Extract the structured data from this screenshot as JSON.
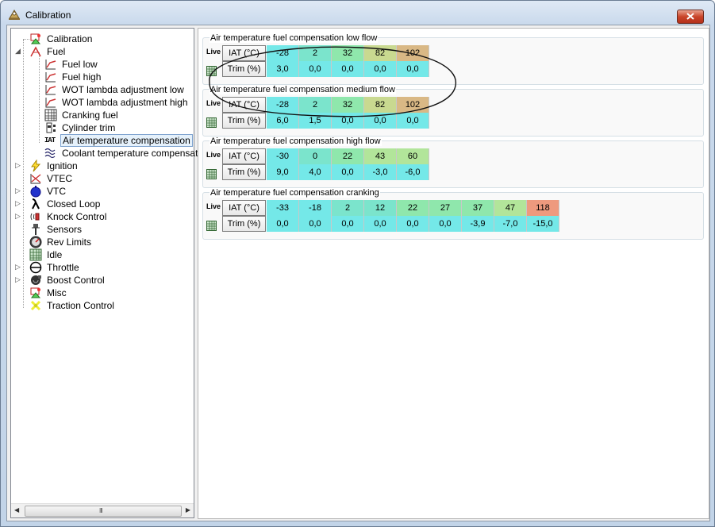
{
  "window": {
    "title": "Calibration"
  },
  "tree": {
    "items": [
      {
        "label": "Calibration"
      },
      {
        "label": "Fuel"
      },
      {
        "label": "Fuel low"
      },
      {
        "label": "Fuel high"
      },
      {
        "label": "WOT lambda adjustment low"
      },
      {
        "label": "WOT lambda adjustment high"
      },
      {
        "label": "Cranking fuel"
      },
      {
        "label": "Cylinder trim"
      },
      {
        "label": "Air temperature compensation"
      },
      {
        "label": "Coolant temperature compensation"
      },
      {
        "label": "Ignition"
      },
      {
        "label": "VTEC"
      },
      {
        "label": "VTC"
      },
      {
        "label": "Closed Loop"
      },
      {
        "label": "Knock Control"
      },
      {
        "label": "Sensors"
      },
      {
        "label": "Rev Limits"
      },
      {
        "label": "Idle"
      },
      {
        "label": "Throttle"
      },
      {
        "label": "Boost Control"
      },
      {
        "label": "Misc"
      },
      {
        "label": "Traction Control"
      }
    ],
    "iat_icon_text": "IAT",
    "scroll_grip": "III"
  },
  "tables": [
    {
      "title": "Air temperature fuel compensation low flow",
      "live_label": "Live",
      "row1_label": "IAT (°C)",
      "row2_label": "Trim (%)",
      "iat": [
        "-28",
        "2",
        "32",
        "82",
        "102"
      ],
      "trim": [
        "3,0",
        "0,0",
        "0,0",
        "0,0",
        "0,0"
      ]
    },
    {
      "title": "Air temperature fuel compensation medium flow",
      "live_label": "Live",
      "row1_label": "IAT (°C)",
      "row2_label": "Trim (%)",
      "iat": [
        "-28",
        "2",
        "32",
        "82",
        "102"
      ],
      "trim": [
        "6,0",
        "1,5",
        "0,0",
        "0,0",
        "0,0"
      ]
    },
    {
      "title": "Air temperature fuel compensation high flow",
      "live_label": "Live",
      "row1_label": "IAT (°C)",
      "row2_label": "Trim (%)",
      "iat": [
        "-30",
        "0",
        "22",
        "43",
        "60"
      ],
      "trim": [
        "9,0",
        "4,0",
        "0,0",
        "-3,0",
        "-6,0"
      ]
    },
    {
      "title": "Air temperature fuel compensation cranking",
      "live_label": "Live",
      "row1_label": "IAT (°C)",
      "row2_label": "Trim (%)",
      "iat": [
        "-33",
        "-18",
        "2",
        "12",
        "22",
        "27",
        "37",
        "47",
        "118"
      ],
      "trim": [
        "0,0",
        "0,0",
        "0,0",
        "0,0",
        "0,0",
        "0,0",
        "-3,9",
        "-7,0",
        "-15,0"
      ]
    }
  ],
  "colors": {
    "cyan": "#74e8e8",
    "teal": "#7be4cc",
    "mint": "#8fe7ac",
    "light_green": "#b2e59a",
    "olive": "#c9d990",
    "tan": "#d9b885",
    "red": "#ee9a7e",
    "selection": "#e5f1fb"
  }
}
